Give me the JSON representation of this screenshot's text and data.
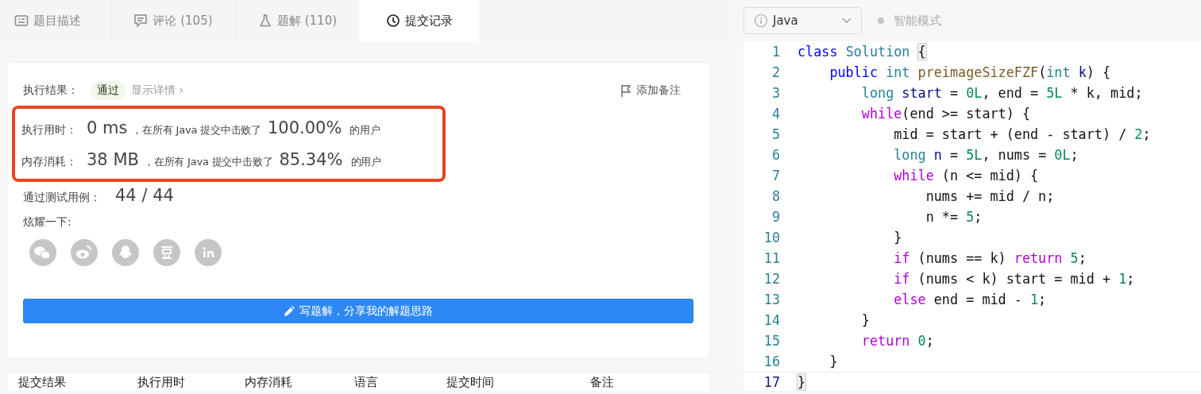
{
  "tabs": [
    {
      "label": "题目描述",
      "kind": "description",
      "selected": false
    },
    {
      "label": "评论 (105)",
      "kind": "comment",
      "selected": false
    },
    {
      "label": "题解 (110)",
      "kind": "flask",
      "selected": false
    },
    {
      "label": "提交记录",
      "kind": "clock",
      "selected": true
    }
  ],
  "result": {
    "label": "执行结果：",
    "status": "通过",
    "details_link": "显示详情 ›",
    "add_note": "添加备注"
  },
  "stats_box": {
    "highlighted": true,
    "rows": [
      {
        "label": "执行用时：",
        "value": "0 ms",
        "text": "，在所有 Java 提交中击败了",
        "percent": "100.00%",
        "suffix": "的用户"
      },
      {
        "label": "内存消耗：",
        "value": "38 MB",
        "text": "，在所有 Java 提交中击败了",
        "percent": "85.34%",
        "suffix": "的用户"
      }
    ]
  },
  "testcases": {
    "label": "通过测试用例：",
    "value": "44 / 44"
  },
  "share": {
    "label": "炫耀一下:",
    "services": [
      {
        "kind": "chat"
      },
      {
        "kind": "swirl"
      },
      {
        "kind": "penguin"
      },
      {
        "kind": "glyph"
      },
      {
        "kind": "in"
      }
    ]
  },
  "write_button": "写题解，分享我的解题思路",
  "history_table": {
    "columns": [
      "提交结果",
      "执行用时",
      "内存消耗",
      "语言",
      "提交时间",
      "备注"
    ]
  },
  "editor": {
    "language": "Java",
    "smart_mode": "智能模式",
    "lines": [
      {
        "number": "1",
        "current": false,
        "tokens": [
          {
            "kind": "kw",
            "text": "class "
          },
          {
            "kind": "type",
            "text": "Solution "
          },
          {
            "kind": "match",
            "text": "{"
          }
        ]
      },
      {
        "number": "2",
        "current": false,
        "tokens": [
          {
            "kind": "kw",
            "text": "    public "
          },
          {
            "kind": "type",
            "text": "int "
          },
          {
            "kind": "fn",
            "text": "preimageSizeFZF"
          },
          {
            "kind": "plain",
            "text": "("
          },
          {
            "kind": "type",
            "text": "int "
          },
          {
            "kind": "var",
            "text": "k"
          },
          {
            "kind": "plain",
            "text": ") {"
          }
        ]
      },
      {
        "number": "3",
        "current": false,
        "tokens": [
          {
            "kind": "type",
            "text": "        long "
          },
          {
            "kind": "var",
            "text": "start"
          },
          {
            "kind": "plain",
            "text": " = "
          },
          {
            "kind": "num",
            "text": "0L"
          },
          {
            "kind": "plain",
            "text": ", end = "
          },
          {
            "kind": "num",
            "text": "5L"
          },
          {
            "kind": "plain",
            "text": " * k, mid;"
          }
        ]
      },
      {
        "number": "4",
        "current": false,
        "tokens": [
          {
            "kind": "ctl",
            "text": "        while"
          },
          {
            "kind": "plain",
            "text": "(end >= start) {"
          }
        ]
      },
      {
        "number": "5",
        "current": false,
        "tokens": [
          {
            "kind": "plain",
            "text": "            mid = start + (end - start) / "
          },
          {
            "kind": "num",
            "text": "2"
          },
          {
            "kind": "plain",
            "text": ";"
          }
        ]
      },
      {
        "number": "6",
        "current": false,
        "tokens": [
          {
            "kind": "type",
            "text": "            long "
          },
          {
            "kind": "var",
            "text": "n"
          },
          {
            "kind": "plain",
            "text": " = "
          },
          {
            "kind": "num",
            "text": "5L"
          },
          {
            "kind": "plain",
            "text": ", nums = "
          },
          {
            "kind": "num",
            "text": "0L"
          },
          {
            "kind": "plain",
            "text": ";"
          }
        ]
      },
      {
        "number": "7",
        "current": false,
        "tokens": [
          {
            "kind": "ctl",
            "text": "            while"
          },
          {
            "kind": "plain",
            "text": " (n <= mid) {"
          }
        ]
      },
      {
        "number": "8",
        "current": false,
        "tokens": [
          {
            "kind": "plain",
            "text": "                nums += mid / n;"
          }
        ]
      },
      {
        "number": "9",
        "current": false,
        "tokens": [
          {
            "kind": "plain",
            "text": "                n *= "
          },
          {
            "kind": "num",
            "text": "5"
          },
          {
            "kind": "plain",
            "text": ";"
          }
        ]
      },
      {
        "number": "10",
        "current": false,
        "tokens": [
          {
            "kind": "plain",
            "text": "            }"
          }
        ]
      },
      {
        "number": "11",
        "current": false,
        "tokens": [
          {
            "kind": "ctl",
            "text": "            if"
          },
          {
            "kind": "plain",
            "text": " (nums == k) "
          },
          {
            "kind": "ctl",
            "text": "return "
          },
          {
            "kind": "num",
            "text": "5"
          },
          {
            "kind": "plain",
            "text": ";"
          }
        ]
      },
      {
        "number": "12",
        "current": false,
        "tokens": [
          {
            "kind": "ctl",
            "text": "            if"
          },
          {
            "kind": "plain",
            "text": " (nums < k) start = mid + "
          },
          {
            "kind": "num",
            "text": "1"
          },
          {
            "kind": "plain",
            "text": ";"
          }
        ]
      },
      {
        "number": "13",
        "current": false,
        "tokens": [
          {
            "kind": "ctl",
            "text": "            else"
          },
          {
            "kind": "plain",
            "text": " end = mid - "
          },
          {
            "kind": "num",
            "text": "1"
          },
          {
            "kind": "plain",
            "text": ";"
          }
        ]
      },
      {
        "number": "14",
        "current": false,
        "tokens": [
          {
            "kind": "plain",
            "text": "        }"
          }
        ]
      },
      {
        "number": "15",
        "current": false,
        "tokens": [
          {
            "kind": "ctl",
            "text": "        return "
          },
          {
            "kind": "num",
            "text": "0"
          },
          {
            "kind": "plain",
            "text": ";"
          }
        ]
      },
      {
        "number": "16",
        "current": false,
        "tokens": [
          {
            "kind": "plain",
            "text": "    }"
          }
        ]
      },
      {
        "number": "17",
        "current": true,
        "tokens": [
          {
            "kind": "match",
            "text": "}"
          }
        ]
      }
    ]
  }
}
